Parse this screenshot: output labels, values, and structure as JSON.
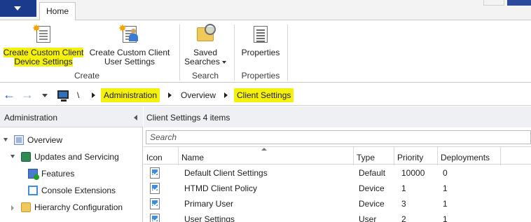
{
  "ribbon": {
    "tabs": [
      {
        "label": "Home"
      }
    ],
    "buttons": {
      "create_device": {
        "line1": "Create Custom Client",
        "line2": "Device Settings"
      },
      "create_user": {
        "line1": "Create Custom Client",
        "line2": "User Settings"
      },
      "saved_searches": {
        "line1": "Saved",
        "line2": "Searches"
      },
      "properties": {
        "label": "Properties"
      }
    },
    "groups": {
      "create": "Create",
      "search": "Search",
      "properties": "Properties"
    }
  },
  "address_bar": {
    "root": "\\",
    "crumbs": [
      "Administration",
      "Overview",
      "Client Settings"
    ]
  },
  "nav_pane": {
    "title": "Administration",
    "tree": [
      {
        "label": "Overview",
        "icon": "overview-icon",
        "expanded": true
      },
      {
        "label": "Updates and Servicing",
        "icon": "updates-icon",
        "expanded": true
      },
      {
        "label": "Features",
        "icon": "features-icon"
      },
      {
        "label": "Console Extensions",
        "icon": "console-extensions-icon"
      },
      {
        "label": "Hierarchy Configuration",
        "icon": "folder-icon",
        "expanded": false
      }
    ]
  },
  "main": {
    "title": "Client Settings 4 items",
    "search_placeholder": "Search",
    "columns": [
      "Icon",
      "Name",
      "Type",
      "Priority",
      "Deployments"
    ],
    "rows": [
      {
        "name": "Default Client Settings",
        "type": "Default",
        "priority": "10000",
        "deployments": "0"
      },
      {
        "name": "HTMD Client Policy",
        "type": "Device",
        "priority": "1",
        "deployments": "1"
      },
      {
        "name": "Primary User",
        "type": "Device",
        "priority": "3",
        "deployments": "1"
      },
      {
        "name": "User Settings",
        "type": "User",
        "priority": "2",
        "deployments": "1"
      }
    ]
  },
  "colors": {
    "highlight": "#f6f10c",
    "app_menu": "#1a3a8c",
    "header_bg": "#eef0f3"
  }
}
